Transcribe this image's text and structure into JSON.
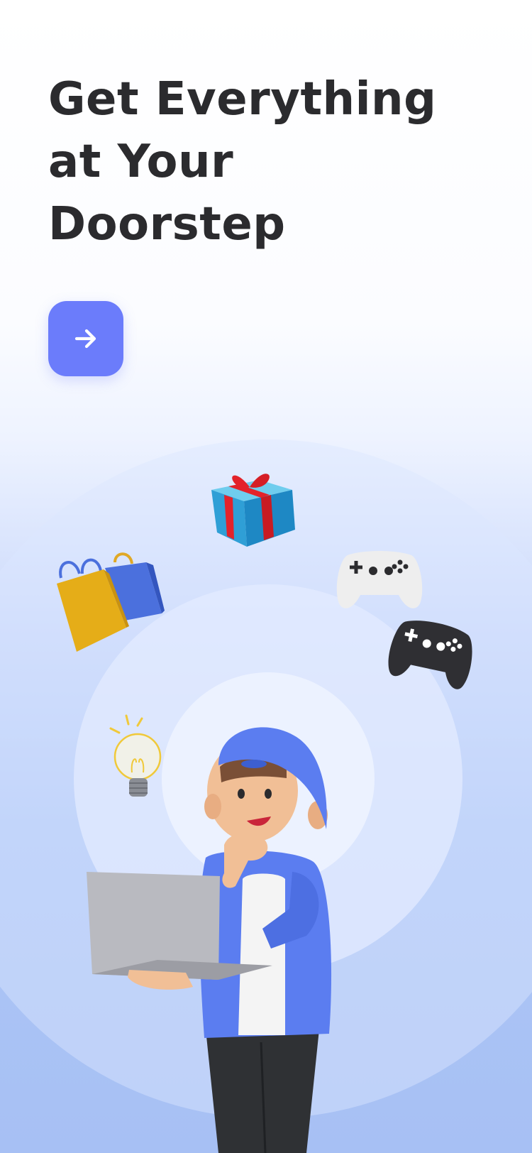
{
  "onboarding": {
    "headline_lines": [
      "Get Everything",
      "at Your",
      "Doorstep"
    ]
  },
  "colors": {
    "accent": "#6b7cfb",
    "headline_text": "#2b2b2e",
    "background_top": "#ffffff",
    "background_bottom": "#a7c0f4"
  },
  "icons": {
    "next_button": "arrow-right-icon",
    "illustration_items": [
      "gift-box-icon",
      "shopping-bags-icon",
      "game-controller-white-icon",
      "game-controller-black-icon",
      "lightbulb-icon",
      "person-with-laptop-illustration"
    ]
  }
}
